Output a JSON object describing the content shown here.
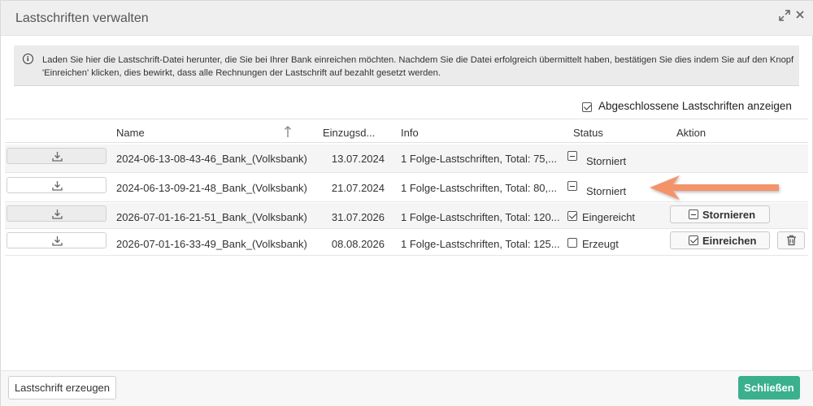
{
  "dialog": {
    "title": "Lastschriften verwalten",
    "expand_icon": "expand-icon",
    "close_icon": "close-icon"
  },
  "info": {
    "icon": "info-icon",
    "text": "Laden Sie hier die Lastschrift-Datei herunter, die Sie bei Ihrer Bank einreichen möchten. Nachdem Sie die Datei erfolgreich übermittelt haben, bestätigen Sie dies indem Sie auf den Knopf 'Einreichen' klicken, dies bewirkt, dass alle Rechnungen der Lastschrift auf bezahlt gesetzt werden."
  },
  "filter": {
    "show_completed_label": "Abgeschlossene Lastschriften anzeigen",
    "show_completed_checked": true
  },
  "table": {
    "columns": {
      "name": "Name",
      "date": "Einzugsd...",
      "info": "Info",
      "status": "Status",
      "action": "Aktion"
    },
    "sort_icon": "sort-ascending-arrow-icon",
    "rows": [
      {
        "name": "2024-06-13-08-43-46_Bank_(Volksbank)",
        "date": "13.07.2024",
        "info": "1 Folge-Lastschriften, Total: 75,...",
        "status": "Storniert",
        "status_icon": "minus-box-icon",
        "action": "",
        "has_delete": false
      },
      {
        "name": "2024-06-13-09-21-48_Bank_(Volksbank)",
        "date": "21.07.2024",
        "info": "1 Folge-Lastschriften, Total: 80,...",
        "status": "Storniert",
        "status_icon": "minus-box-icon",
        "action": "",
        "has_delete": false
      },
      {
        "name": "2026-07-01-16-21-51_Bank_(Volksbank)",
        "date": "31.07.2026",
        "info": "1 Folge-Lastschriften, Total: 120...",
        "status": "Eingereicht",
        "status_icon": "checked-box-icon",
        "action": "Stornieren",
        "has_delete": false
      },
      {
        "name": "2026-07-01-16-33-49_Bank_(Volksbank)",
        "date": "08.08.2026",
        "info": "1 Folge-Lastschriften, Total: 125...",
        "status": "Erzeugt",
        "status_icon": "empty-box-icon",
        "action": "Einreichen",
        "has_delete": true
      }
    ]
  },
  "annotation": {
    "arrow_color": "#f4936b"
  },
  "footer": {
    "create_label": "Lastschrift erzeugen",
    "close_label": "Schließen",
    "close_color": "#3bb08c"
  }
}
